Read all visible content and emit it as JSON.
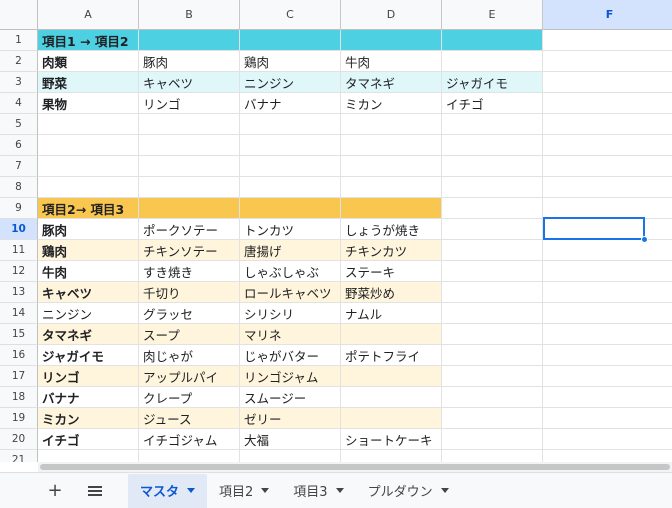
{
  "columns": [
    "A",
    "B",
    "C",
    "D",
    "E",
    "F"
  ],
  "active_column": "F",
  "active_row": 10,
  "colors": {
    "header_teal": "#4dd0e1",
    "header_orange": "#f9c74f",
    "band_light_blue": "#e0f7fa",
    "band_light_yellow": "#fef5dc",
    "selection_blue": "#1a73e8"
  },
  "rows": [
    {
      "num": "1",
      "cells": [
        "項目1 → 項目2",
        "",
        "",
        "",
        ""
      ],
      "style": "teal-header"
    },
    {
      "num": "2",
      "cells": [
        "肉類",
        "豚肉",
        "鶏肉",
        "牛肉",
        ""
      ],
      "style": "plain"
    },
    {
      "num": "3",
      "cells": [
        "野菜",
        "キャベツ",
        "ニンジン",
        "タマネギ",
        "ジャガイモ"
      ],
      "style": "blue-band"
    },
    {
      "num": "4",
      "cells": [
        "果物",
        "リンゴ",
        "バナナ",
        "ミカン",
        "イチゴ"
      ],
      "style": "plain"
    },
    {
      "num": "5",
      "cells": [
        "",
        "",
        "",
        "",
        ""
      ],
      "style": "empty"
    },
    {
      "num": "6",
      "cells": [
        "",
        "",
        "",
        "",
        ""
      ],
      "style": "empty"
    },
    {
      "num": "7",
      "cells": [
        "",
        "",
        "",
        "",
        ""
      ],
      "style": "empty"
    },
    {
      "num": "8",
      "cells": [
        "",
        "",
        "",
        "",
        ""
      ],
      "style": "empty"
    },
    {
      "num": "9",
      "cells": [
        "項目2→ 項目3",
        "",
        "",
        "",
        ""
      ],
      "style": "orange-header"
    },
    {
      "num": "10",
      "cells": [
        "豚肉",
        "ポークソテー",
        "トンカツ",
        "しょうが焼き",
        ""
      ],
      "style": "plain"
    },
    {
      "num": "11",
      "cells": [
        "鶏肉",
        "チキンソテー",
        "唐揚げ",
        "チキンカツ",
        ""
      ],
      "style": "yellow-band"
    },
    {
      "num": "12",
      "cells": [
        "牛肉",
        "すき焼き",
        "しゃぶしゃぶ",
        "ステーキ",
        ""
      ],
      "style": "plain"
    },
    {
      "num": "13",
      "cells": [
        "キャベツ",
        "千切り",
        "ロールキャベツ",
        "野菜炒め",
        ""
      ],
      "style": "yellow-band"
    },
    {
      "num": "14",
      "cells": [
        "ニンジン",
        "グラッセ",
        "シリシリ",
        "ナムル",
        ""
      ],
      "style": "plain-normal"
    },
    {
      "num": "15",
      "cells": [
        "タマネギ",
        "スープ",
        "マリネ",
        "",
        ""
      ],
      "style": "yellow-band"
    },
    {
      "num": "16",
      "cells": [
        "ジャガイモ",
        "肉じゃが",
        "じゃがバター",
        "ポテトフライ",
        ""
      ],
      "style": "plain"
    },
    {
      "num": "17",
      "cells": [
        "リンゴ",
        "アップルパイ",
        "リンゴジャム",
        "",
        ""
      ],
      "style": "yellow-band"
    },
    {
      "num": "18",
      "cells": [
        "バナナ",
        "クレープ",
        "スムージー",
        "",
        ""
      ],
      "style": "plain"
    },
    {
      "num": "19",
      "cells": [
        "ミカン",
        "ジュース",
        "ゼリー",
        "",
        ""
      ],
      "style": "yellow-band"
    },
    {
      "num": "20",
      "cells": [
        "イチゴ",
        "イチゴジャム",
        "大福",
        "ショートケーキ",
        ""
      ],
      "style": "plain"
    },
    {
      "num": "21",
      "cells": [
        "",
        "",
        "",
        "",
        ""
      ],
      "style": "empty"
    }
  ],
  "sheet_bar": {
    "add_icon": "plus-icon",
    "menu_icon": "menu-icon",
    "tabs": [
      {
        "label": "マスタ",
        "active": true
      },
      {
        "label": "項目2",
        "active": false
      },
      {
        "label": "項目3",
        "active": false
      },
      {
        "label": "プルダウン",
        "active": false
      }
    ]
  }
}
